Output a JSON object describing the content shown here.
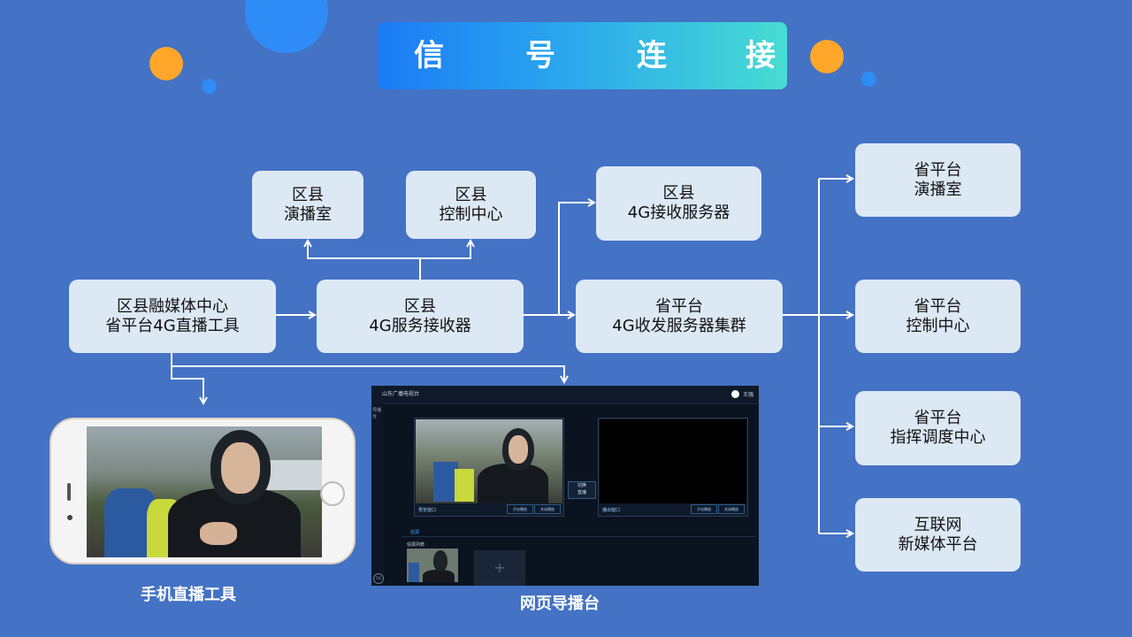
{
  "title": {
    "chars": [
      "信",
      "号",
      "连",
      "接"
    ]
  },
  "nodes": {
    "county_studio": {
      "line1": "区县",
      "line2": "演播室"
    },
    "county_control": {
      "line1": "区县",
      "line2": "控制中心"
    },
    "county_4g_server": {
      "line1": "区县",
      "line2": "4G接收服务器"
    },
    "county_media_center": {
      "line1": "区县融媒体中心",
      "line2": "省平台4G直播工具"
    },
    "county_4g_receiver": {
      "line1": "区县",
      "line2": "4G服务接收器"
    },
    "prov_4g_cluster": {
      "line1": "省平台",
      "line2": "4G收发服务器集群"
    },
    "prov_studio": {
      "line1": "省平台",
      "line2": "演播室"
    },
    "prov_control": {
      "line1": "省平台",
      "line2": "控制中心"
    },
    "prov_command": {
      "line1": "省平台",
      "line2": "指挥调度中心"
    },
    "internet": {
      "line1": "互联网",
      "line2": "新媒体平台"
    }
  },
  "captions": {
    "phone": "手机直播工具",
    "web": "网页导播台"
  },
  "console": {
    "header_title": "山东广播电视台",
    "user": "王强",
    "side_label": "导播台",
    "preview_label": "预览窗口",
    "program_label": "播出窗口",
    "btn_a": "开启播放",
    "btn_b": "关闭播放",
    "mid_a": "切换",
    "mid_b": "直播",
    "section": "信源",
    "sub": "信源列表",
    "add": "+",
    "badge": "5G"
  },
  "colors": {
    "background": "#4472c4",
    "node": "#dde8f5",
    "line": "#ffffff",
    "orange": "#ffa62b",
    "blue": "#2f8cf6"
  }
}
